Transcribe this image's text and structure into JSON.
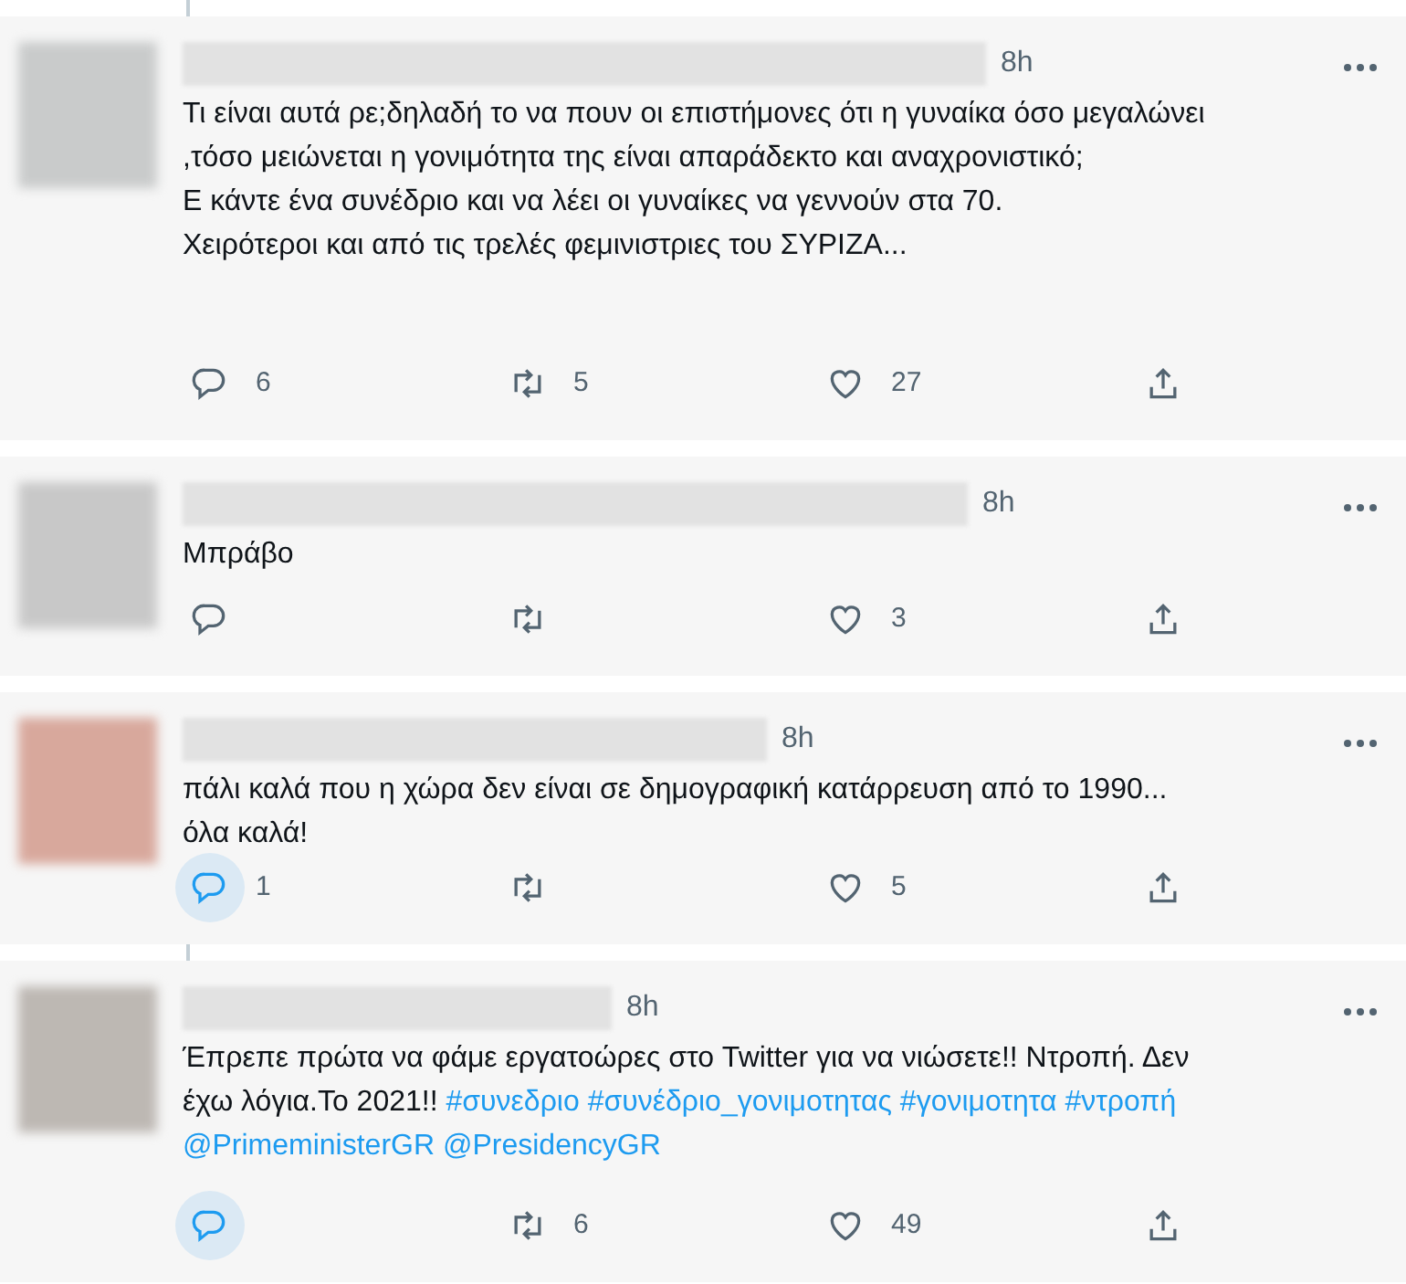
{
  "tweets": [
    {
      "time": "8h",
      "thread_line_above": true,
      "body": [
        {
          "kind": "text",
          "text": "Τι είναι αυτά ρε;δηλαδή το να πουν οι επιστήμονες ότι η γυναίκα όσο μεγαλώνει ,τόσο μειώνεται η γονιμότητα της είναι απαράδεκτο και αναχρονιστικό;\nΕ κάντε ένα συνέδριο και να λέει οι γυναίκες να γεννούν στα 70.\nΧειρότεροι και από τις τρελές φεμινιστριες του ΣΥΡΙΖΑ..."
        }
      ],
      "replies": "6",
      "retweets": "5",
      "likes": "27",
      "reply_highlighted": false
    },
    {
      "time": "8h",
      "thread_line_above": false,
      "body": [
        {
          "kind": "text",
          "text": "Μπράβο"
        }
      ],
      "likes": "3",
      "reply_highlighted": false
    },
    {
      "time": "8h",
      "thread_line_above": false,
      "body": [
        {
          "kind": "text",
          "text": "πάλι καλά που η χώρα δεν είναι σε δημογραφική κατάρρευση από το 1990... όλα καλά!"
        }
      ],
      "replies": "1",
      "likes": "5",
      "reply_highlighted": true
    },
    {
      "time": "8h",
      "thread_line_above": true,
      "body": [
        {
          "kind": "text",
          "text": "Έπρεπε πρώτα να φάμε εργατοώρες στο Twitter για να νιώσετε!! Ντροπή. Δεν έχω λόγια.Το 2021!!"
        },
        {
          "kind": "link",
          "text": "#συνεδριο"
        },
        {
          "kind": "link",
          "text": "#συνέδριο_γονιμοτητας"
        },
        {
          "kind": "link",
          "text": "#γονιμοτητα"
        },
        {
          "kind": "link",
          "text": "#ντροπή"
        },
        {
          "kind": "link",
          "text": "@PrimeministerGR"
        },
        {
          "kind": "link",
          "text": "@PresidencyGR"
        }
      ],
      "retweets": "6",
      "likes": "49",
      "reply_highlighted": true
    }
  ]
}
